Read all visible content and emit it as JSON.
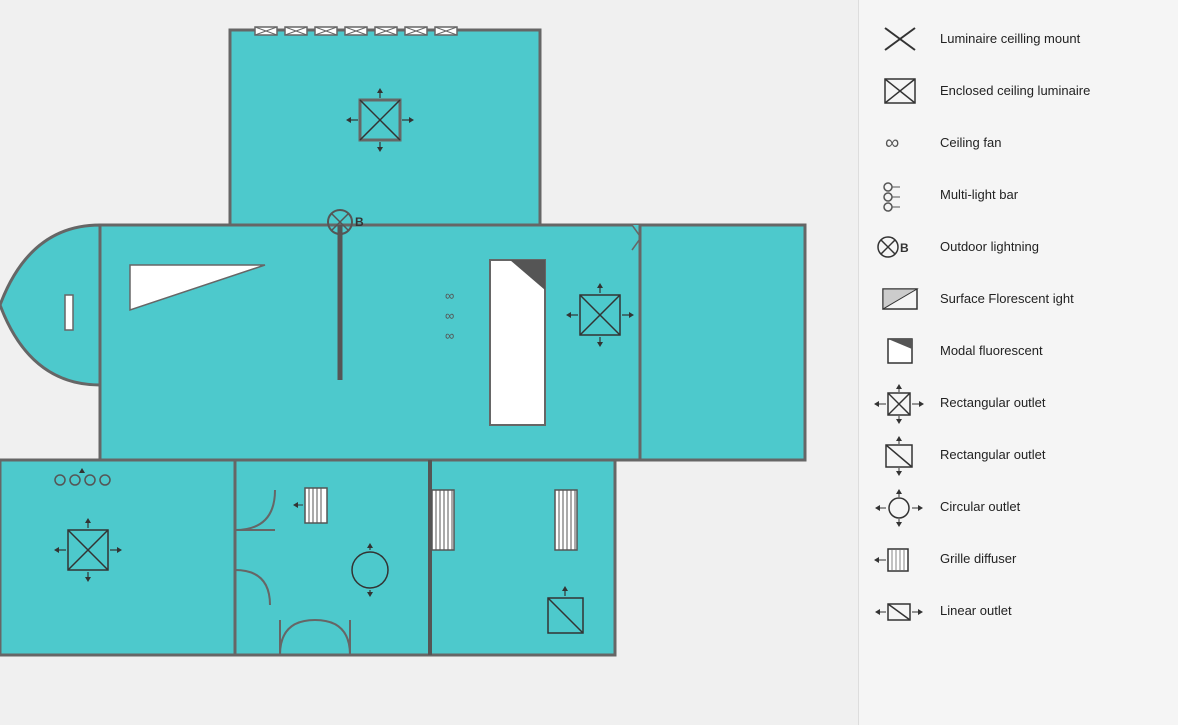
{
  "legend": {
    "items": [
      {
        "id": "luminaire-ceiling-mount",
        "label": "Luminaire ceilling mount"
      },
      {
        "id": "enclosed-ceiling-luminaire",
        "label": "Enclosed ceiling luminaire"
      },
      {
        "id": "ceiling-fan",
        "label": "Ceiling fan"
      },
      {
        "id": "multi-light-bar",
        "label": "Multi-light bar"
      },
      {
        "id": "outdoor-lightning",
        "label": "Outdoor lightning"
      },
      {
        "id": "surface-florescent-light",
        "label": "Surface Florescent ight"
      },
      {
        "id": "modal-fluorescent",
        "label": "Modal fluorescent"
      },
      {
        "id": "rectangular-outlet-1",
        "label": "Rectangular outlet"
      },
      {
        "id": "rectangular-outlet-2",
        "label": "Rectangular outlet"
      },
      {
        "id": "circular-outlet",
        "label": "Circular outlet"
      },
      {
        "id": "grille-diffuser",
        "label": "Grille diffuser"
      },
      {
        "id": "linear-outlet",
        "label": "Linear outlet"
      }
    ]
  }
}
